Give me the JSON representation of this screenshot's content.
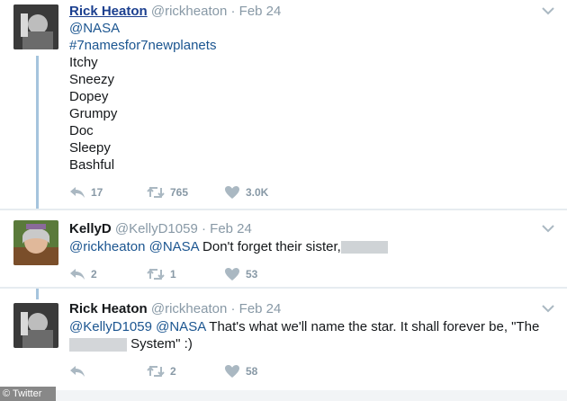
{
  "tweets": [
    {
      "name": "Rick Heaton",
      "handle": "@rickheaton",
      "dot": "·",
      "date": "Feb 24",
      "lines": [
        "@NASA",
        "#7namesfor7newplanets",
        "Itchy",
        "Sneezy",
        "Dopey",
        "Grumpy",
        "Doc",
        "Sleepy",
        "Bashful"
      ],
      "reply_count": "17",
      "retweet_count": "765",
      "like_count": "3.0K"
    },
    {
      "name": "KellyD",
      "handle": "@KellyD1059",
      "dot": "·",
      "date": "Feb 24",
      "mention1": "@rickheaton",
      "mention2": "@NASA",
      "text": "Don't forget their sister,",
      "reply_count": "2",
      "retweet_count": "1",
      "like_count": "53"
    },
    {
      "name": "Rick Heaton",
      "handle": "@rickheaton",
      "dot": "·",
      "date": "Feb 24",
      "mention1": "@KellyD1059",
      "mention2": "@NASA",
      "text_line1": "That's what we'll name the star. It shall forever be, \"The",
      "text_line2": "System\" :)",
      "retweet_count": "2",
      "like_count": "58"
    }
  ],
  "watermark": "© Twitter",
  "icons": {
    "reply": "reply-icon",
    "retweet": "retweet-icon",
    "like": "heart-icon",
    "caret": "chevron-down-icon"
  },
  "colors": {
    "link": "#1b5590",
    "muted": "#8899a6",
    "thread_line": "#a5c4dd"
  }
}
